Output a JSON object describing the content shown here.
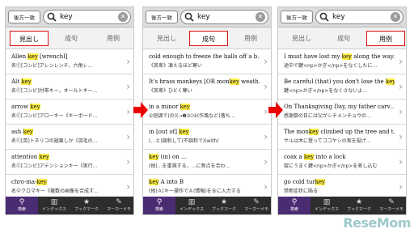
{
  "colors": {
    "accent": "#dd1111",
    "nav_selected": "#4a2c73",
    "highlight": "#ffee44",
    "arrow": "#ee0000"
  },
  "screens": [
    {
      "mode_label": "後方一致",
      "query": "key",
      "tabs": [
        "見出し",
        "成句",
        "用例"
      ],
      "selected_tab": 0,
      "rows": [
        {
          "pre": "Allen ",
          "hl": "key",
          "post": " [wrenchⅠ]",
          "sub": "名Ⓒ[コンピ]アレンレンチ，六角レ…"
        },
        {
          "pre": "Alt ",
          "hl": "key",
          "post": "",
          "sub": "名Ⓒ[コンピ]付帯キー，オールトキー…"
        },
        {
          "pre": "arrow ",
          "hl": "key",
          "post": "",
          "sub": "名Ⓒ[コンピ]アローキー《キーボード…"
        },
        {
          "pre": "ash ",
          "hl": "key",
          "post": "",
          "sub": "名Ⓒ[英]トネリコの翅果しか《羽毛の…"
        },
        {
          "pre": "attention ",
          "hl": "key",
          "post": "",
          "sub": "名Ⓒ[コンピ]アテンションキー《実行…"
        },
        {
          "pre": "chro·ma-",
          "hl": "key",
          "post": "",
          "sub": "名Ⓤクロマキー《複数の画像を合成す…"
        }
      ],
      "nav": [
        {
          "icon": "magnifier-icon",
          "glyph": "⚲",
          "label": "検索"
        },
        {
          "icon": "book-icon",
          "glyph": "▥",
          "label": "インデックス"
        },
        {
          "icon": "star-icon",
          "glyph": "★",
          "label": "ブックマーク"
        },
        {
          "icon": "pencil-icon",
          "glyph": "✎",
          "label": "マーカーメモ"
        }
      ],
      "nav_selected": 0
    },
    {
      "mode_label": "後方一致",
      "query": "key",
      "tabs": [
        "見出し",
        "成句",
        "用例"
      ],
      "selected_tab": 1,
      "rows": [
        {
          "pre": "cold enough to freeze the balls off a b…",
          "hl": "",
          "post": "",
          "sub": "《英卑》凍えるほど寒い"
        },
        {
          "pre": "It's brass monkeys [OR mon",
          "hl": "key",
          "post": " weath…",
          "sub": "《英卑》ひどく寒い"
        },
        {
          "pre": "in a minor ",
          "hl": "key",
          "post": "",
          "sub": "①短調で(の)(→❶②)②(作風など)落ち…"
        },
        {
          "pre": "in [out of] ",
          "hl": "key",
          "post": "",
          "sub": "(…と)調和して(不調和で)(with)"
        },
        {
          "pre": "",
          "hl": "key",
          "post": " (in) on …",
          "sub": "(他)…を重視する，…に焦点を合わ…"
        },
        {
          "pre": "",
          "hl": "key",
          "post": " A into B",
          "sub": "(他)Ａ(キー操作でＡ(情報)をＢに入力する"
        }
      ],
      "nav": [
        {
          "icon": "magnifier-icon",
          "glyph": "⚲",
          "label": "検索"
        },
        {
          "icon": "book-icon",
          "glyph": "▥",
          "label": "インデックス"
        },
        {
          "icon": "star-icon",
          "glyph": "★",
          "label": "ブックマーク"
        },
        {
          "icon": "pencil-icon",
          "glyph": "✎",
          "label": "マーカーメモ"
        }
      ],
      "nav_selected": 0
    },
    {
      "mode_label": "後方一致",
      "query": "key",
      "tabs": [
        "見出し",
        "成句",
        "用例"
      ],
      "selected_tab": 2,
      "rows": [
        {
          "pre": "I must have lost my ",
          "hl": "key",
          "post": " along the way.",
          "sub": "途中で鍵<np>かぎ</np>をなくしたに…"
        },
        {
          "pre": "Be careful (that) you don't lose the ",
          "hl": "key",
          "post": "",
          "sub": "鍵<np>かぎ</np>をなくさないよ…"
        },
        {
          "pre": "On Thanksgiving Day, my father carv…",
          "hl": "",
          "post": "",
          "sub": "感謝祭の日には父がシチメンチョウの…"
        },
        {
          "pre": "The mon",
          "hl": "key",
          "post": " climbed up the tree and t…",
          "sub": "サルは木に登ってココヤシの実を投げ…"
        },
        {
          "pre": "coax a ",
          "hl": "key",
          "post": " into a lock",
          "sub": "錠にうまく鍵<np>かぎ</np>を差し込む"
        },
        {
          "pre": "go cold tur",
          "hl": "key",
          "post": "",
          "sub": "禁断症状に陥る"
        }
      ],
      "nav": [
        {
          "icon": "magnifier-icon",
          "glyph": "⚲",
          "label": "検索"
        },
        {
          "icon": "book-icon",
          "glyph": "▥",
          "label": "インデックス"
        },
        {
          "icon": "star-icon",
          "glyph": "★",
          "label": "ブックマーク"
        },
        {
          "icon": "pencil-icon",
          "glyph": "✎",
          "label": "マーカーメモ"
        }
      ],
      "nav_selected": 0
    }
  ],
  "watermark": "ReseMom"
}
